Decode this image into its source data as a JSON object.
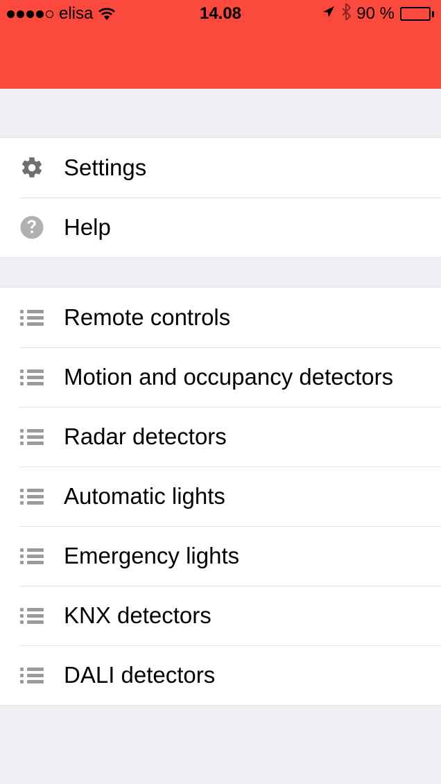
{
  "statusbar": {
    "carrier": "elisa",
    "time": "14.08",
    "battery": "90 %"
  },
  "menu": {
    "top": [
      {
        "label": "Settings",
        "icon": "gear"
      },
      {
        "label": "Help",
        "icon": "question"
      }
    ],
    "categories": [
      {
        "label": "Remote controls"
      },
      {
        "label": "Motion and occupancy detectors"
      },
      {
        "label": "Radar detectors"
      },
      {
        "label": "Automatic lights"
      },
      {
        "label": "Emergency lights"
      },
      {
        "label": "KNX detectors"
      },
      {
        "label": "DALI detectors"
      }
    ]
  }
}
